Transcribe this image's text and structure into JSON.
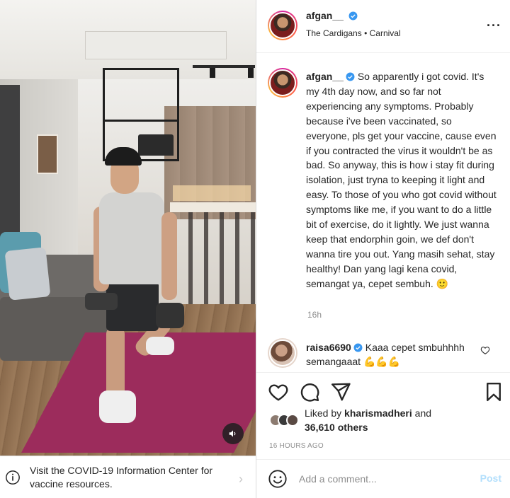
{
  "banner": {
    "text": "Visit the COVID-19 Information Center for vaccine resources.",
    "icon": "info-icon"
  },
  "header": {
    "username": "afgan__",
    "audio_artist": "The Cardigans",
    "audio_separator": "•",
    "audio_track": "Carnival",
    "more_label": "···"
  },
  "caption": {
    "username": "afgan__",
    "text": "So apparently i got covid. It's my 4th day now, and so far not experiencing any symptoms. Probably because i've been vaccinated, so everyone, pls get your vaccine, cause even if you contracted the virus it wouldn't be as bad. So anyway, this is how i stay fit during isolation, just tryna to keeping it light and easy. To those of you who got covid without symptoms like me, if you want to do a little bit of exercise, do it lightly. We just wanna keep that endorphin goin, we def don't wanna tire you out. Yang masih sehat, stay healthy! Dan yang lagi kena covid, semangat ya, cepet sembuh.",
    "emoji": "🙂",
    "time": "16h"
  },
  "comment": {
    "username": "raisa6690",
    "text": "Kaaa cepet smbuhhhh semangaaat",
    "emoji": "💪💪💪"
  },
  "likes": {
    "prefix": "Liked by",
    "user": "kharismadheri",
    "mid": "and",
    "others": "36,610 others"
  },
  "timestamp": "16 HOURS AGO",
  "add_comment": {
    "placeholder": "Add a comment...",
    "post_label": "Post"
  },
  "colors": {
    "verified": "#3897f0",
    "post_disabled": "#b2dffc",
    "mat": "#9c2c5c"
  }
}
